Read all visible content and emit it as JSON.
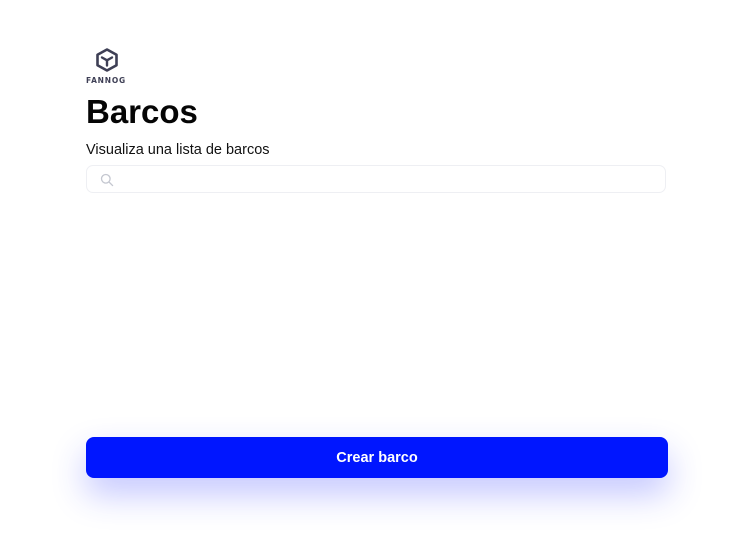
{
  "brand": {
    "name": "FANNOG",
    "logo_icon": "hexagon-cube-icon",
    "color": "#3e3f55"
  },
  "header": {
    "title": "Barcos",
    "subtitle": "Visualiza una lista de barcos"
  },
  "search": {
    "icon": "search-icon",
    "value": "",
    "placeholder": ""
  },
  "actions": {
    "create_label": "Crear barco",
    "accent_color": "#0016ff"
  }
}
